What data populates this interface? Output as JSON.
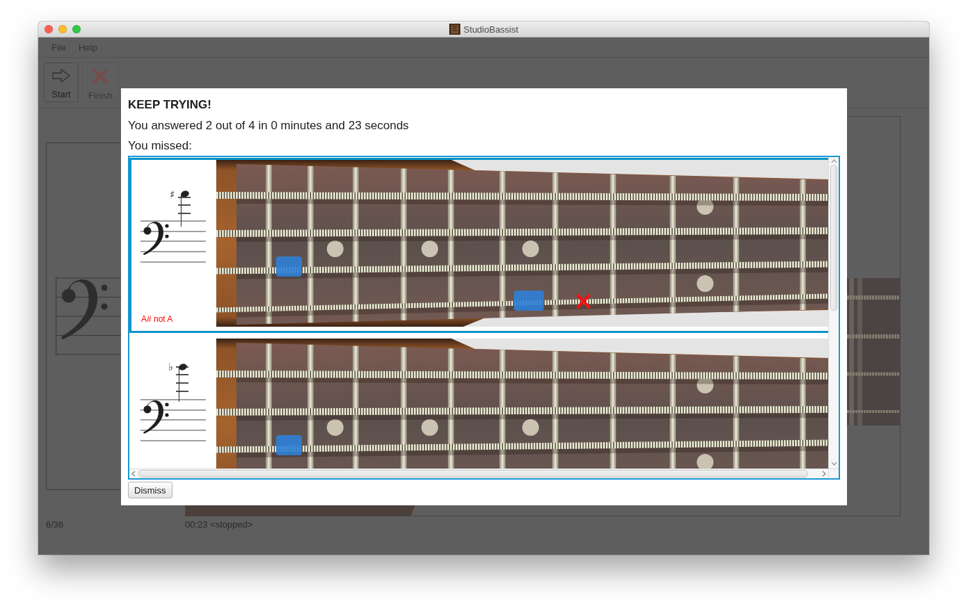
{
  "window": {
    "title": "StudioBassist"
  },
  "menu": [
    {
      "label": "File"
    },
    {
      "label": "Help"
    }
  ],
  "toolbar": [
    {
      "label": "Start",
      "kind": "start",
      "disabled": false
    },
    {
      "label": "Finish",
      "kind": "finish",
      "disabled": true
    }
  ],
  "dialog": {
    "heading": "KEEP TRYING!",
    "summary": "You answered 2 out of 4 in 0 minutes and 23 seconds",
    "missed_label": "You missed:",
    "missed": [
      {
        "kind": "sharp",
        "accidental": "♯",
        "caption": "A# not A",
        "wrong_mark": true,
        "selected": true
      },
      {
        "kind": "flat",
        "accidental": "♭",
        "selected": false
      }
    ],
    "dismiss": "Dismiss"
  },
  "status_bar": {
    "progress": "6/36",
    "timer": "00:23 <stopped>"
  }
}
